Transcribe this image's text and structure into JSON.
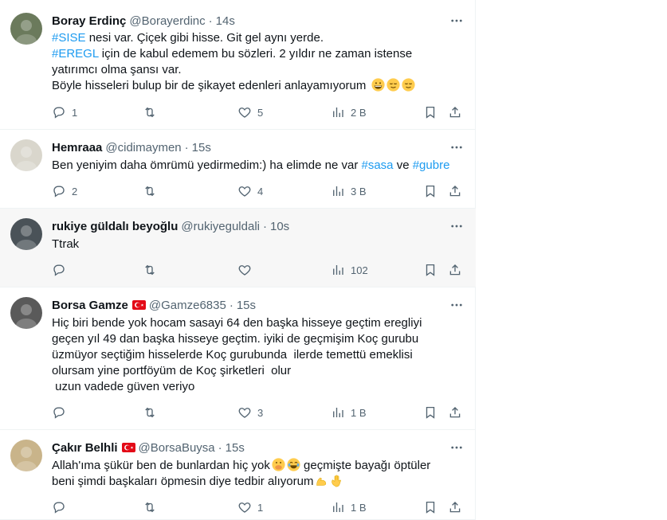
{
  "tweets": [
    {
      "name": "Boray Erdinç",
      "handle": "@Borayerdinc",
      "time": "14s",
      "flag": false,
      "lines": [
        [
          {
            "t": "#SISE",
            "tag": true
          },
          {
            "t": " nesi var. Çiçek gibi hisse. Git gel aynı yerde.",
            "tag": false
          }
        ],
        [
          {
            "t": "#EREGL",
            "tag": true
          },
          {
            "t": " için de kabul edemem bu sözleri. 2 yıldır ne zaman istense",
            "tag": false
          }
        ],
        [
          {
            "t": "yatırımcı olma şansı var.",
            "tag": false
          }
        ],
        [
          {
            "t": "Böyle hisseleri bulup bir de şikayet edenleri anlayamıyorum",
            "tag": false
          }
        ]
      ],
      "emojis": [
        "grinning-face",
        "relieved-face",
        "relieved-face"
      ],
      "replies": "1",
      "retweets": "",
      "likes": "5",
      "views": "2 B",
      "avatar_color": "#6b7a5c"
    },
    {
      "name": "Hemraaa",
      "handle": "@cidimaymen",
      "time": "15s",
      "flag": false,
      "lines": [
        [
          {
            "t": "Ben yeniyim daha ömrümü yedirmedim:) ha elimde ne var ",
            "tag": false
          },
          {
            "t": "#sasa",
            "tag": true
          },
          {
            "t": " ve ",
            "tag": false
          },
          {
            "t": "#gubre",
            "tag": true
          }
        ]
      ],
      "emojis": [],
      "replies": "2",
      "retweets": "",
      "likes": "4",
      "views": "3 B",
      "avatar_color": "#d9d6cc"
    },
    {
      "name": "rukiye güldalı beyoğlu",
      "handle": "@rukiyeguldali",
      "time": "10s",
      "flag": false,
      "lines": [
        [
          {
            "t": "Ttrak",
            "tag": false
          }
        ]
      ],
      "emojis": [],
      "replies": "",
      "retweets": "",
      "likes": "",
      "views": "102",
      "avatar_color": "#4a5258"
    },
    {
      "name": "Borsa Gamze",
      "handle": "@Gamze6835",
      "time": "15s",
      "flag": true,
      "lines": [
        [
          {
            "t": "Hiç biri bende yok hocam sasayi 64 den başka hisseye geçtim eregliyi",
            "tag": false
          }
        ],
        [
          {
            "t": "geçen yıl 49 dan başka hisseye geçtim. iyiki de geçmişim Koç gurubu",
            "tag": false
          }
        ],
        [
          {
            "t": "üzmüyor seçtiğim hisselerde Koç gurubunda  ilerde temettü emeklisi",
            "tag": false
          }
        ],
        [
          {
            "t": "olursam yine portföyüm de Koç şirketleri  olur",
            "tag": false
          }
        ],
        [
          {
            "t": " uzun vadede güven veriyo",
            "tag": false
          }
        ]
      ],
      "emojis": [],
      "replies": "",
      "retweets": "",
      "likes": "3",
      "views": "1 B",
      "avatar_color": "#5a5a5a"
    },
    {
      "name": "Çakır Belhli",
      "handle": "@BorsaBuysa",
      "time": "15s",
      "flag": true,
      "lines": [
        [
          {
            "t": "Allah'ıma şükür ben de bunlardan hiç yok",
            "tag": false
          }
        ],
        [
          {
            "t": "beni şimdi başkaları öpmesin diye tedbir alıyorum",
            "tag": false
          }
        ]
      ],
      "emojis": [],
      "line_emojis": [
        [
          "hand-over-mouth-face",
          "tears-of-joy-face"
        ],
        [
          "flexed-biceps-emoji",
          "waving-hand-emoji"
        ]
      ],
      "line_tail": [
        " geçmişte bayağı öptüler",
        ""
      ],
      "replies": "",
      "retweets": "",
      "likes": "1",
      "views": "1 B",
      "avatar_color": "#c9b48a"
    }
  ],
  "icons": {
    "more": "more-horizontal-icon",
    "reply": "reply-icon",
    "retweet": "retweet-icon",
    "like": "like-heart-icon",
    "views": "views-chart-icon",
    "bookmark": "bookmark-icon",
    "share": "share-icon"
  },
  "colors": {
    "hashtag": "#1d9bf0",
    "secondary_text": "#536471",
    "divider": "#eff3f4",
    "highlight_row": "#f7f7f7",
    "flag_red": "#e30a17"
  }
}
